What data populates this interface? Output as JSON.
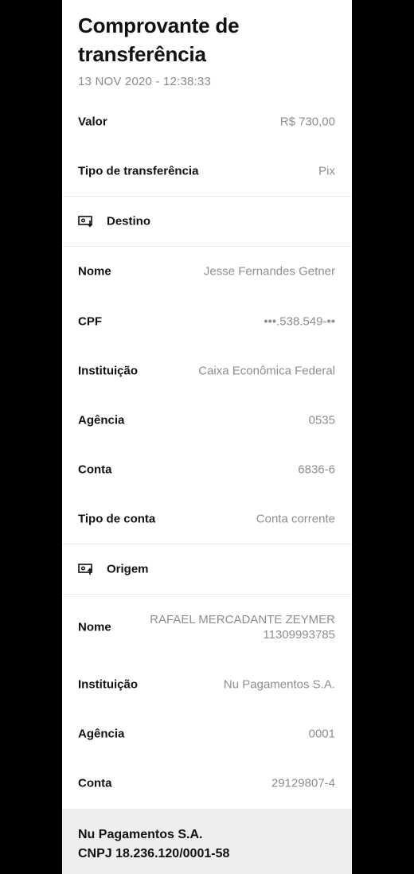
{
  "header": {
    "title": "Comprovante de transferência",
    "date": "13 NOV 2020 - 12:38:33"
  },
  "summary": {
    "valor_label": "Valor",
    "valor_value": "R$ 730,00",
    "tipo_label": "Tipo de transferência",
    "tipo_value": "Pix"
  },
  "destino": {
    "section_label": "Destino",
    "icon": "money-in-icon",
    "nome_label": "Nome",
    "nome_value": "Jesse Fernandes Getner",
    "cpf_label": "CPF",
    "cpf_value": "•••.538.549-••",
    "instituicao_label": "Instituição",
    "instituicao_value": "Caixa Econômica Federal",
    "agencia_label": "Agência",
    "agencia_value": "0535",
    "conta_label": "Conta",
    "conta_value": "6836-6",
    "tipo_conta_label": "Tipo de conta",
    "tipo_conta_value": "Conta corrente"
  },
  "origem": {
    "section_label": "Origem",
    "icon": "money-out-icon",
    "nome_label": "Nome",
    "nome_value_line1": "RAFAEL MERCADANTE ZEYMER",
    "nome_value_line2": "11309993785",
    "instituicao_label": "Instituição",
    "instituicao_value": "Nu Pagamentos S.A.",
    "agencia_label": "Agência",
    "agencia_value": "0001",
    "conta_label": "Conta",
    "conta_value": "29129807-4"
  },
  "footer": {
    "company": "Nu Pagamentos S.A.",
    "cnpj": "CNPJ 18.236.120/0001-58"
  }
}
